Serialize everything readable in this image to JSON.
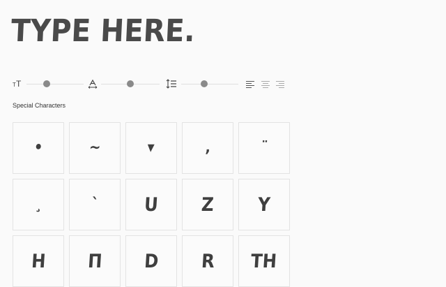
{
  "preview_text": "TYPE HERE.",
  "controls": {
    "font_size_icon": "font-size-icon",
    "letter_spacing_icon": "letter-spacing-icon",
    "line_height_icon": "line-height-icon",
    "font_size_value": 0.35,
    "letter_spacing_value": 0.5,
    "line_height_value": 0.4,
    "alignment_options": [
      "left",
      "center",
      "right"
    ],
    "alignment_selected": "left"
  },
  "special_characters": {
    "label": "Special Characters",
    "glyphs": [
      [
        "•",
        "~",
        "▾",
        "‚",
        "¨"
      ],
      [
        "¸",
        "`",
        "U",
        "Z",
        "Y"
      ],
      [
        "H",
        "П",
        "D",
        "R",
        "TH"
      ]
    ]
  },
  "colors": {
    "background": "#fafafa",
    "text": "#4a4a4a",
    "knob": "#8a8a8a",
    "track": "#e0e0e0",
    "cell_border": "#e3e3e3"
  }
}
